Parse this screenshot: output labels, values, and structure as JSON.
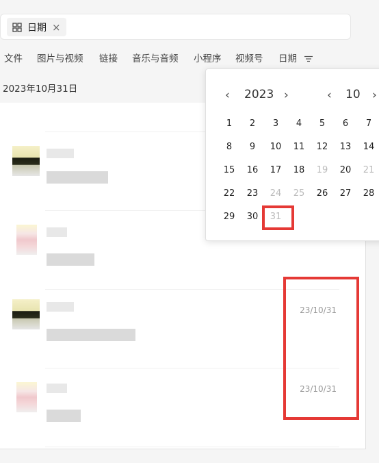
{
  "search": {
    "chip_label": "日期"
  },
  "tabs": [
    "文件",
    "图片与视频",
    "链接",
    "音乐与音频",
    "小程序",
    "视频号",
    "日期"
  ],
  "date_header": "2023年10月31日",
  "items": [
    {
      "date": ""
    },
    {
      "date": ""
    },
    {
      "date": "23/10/31"
    },
    {
      "date": "23/10/31"
    }
  ],
  "calendar": {
    "year": "2023",
    "month": "10",
    "prev": "‹",
    "next": "›",
    "rows": [
      [
        "1",
        "2",
        "3",
        "4",
        "5",
        "6",
        "7"
      ],
      [
        "8",
        "9",
        "10",
        "11",
        "12",
        "13",
        "14"
      ],
      [
        "15",
        "16",
        "17",
        "18",
        "19",
        "20",
        "21"
      ],
      [
        "22",
        "23",
        "24",
        "25",
        "26",
        "27",
        "28"
      ],
      [
        "29",
        "30",
        "31"
      ]
    ],
    "muted": [
      "19",
      "21",
      "24",
      "25",
      "31"
    ]
  }
}
